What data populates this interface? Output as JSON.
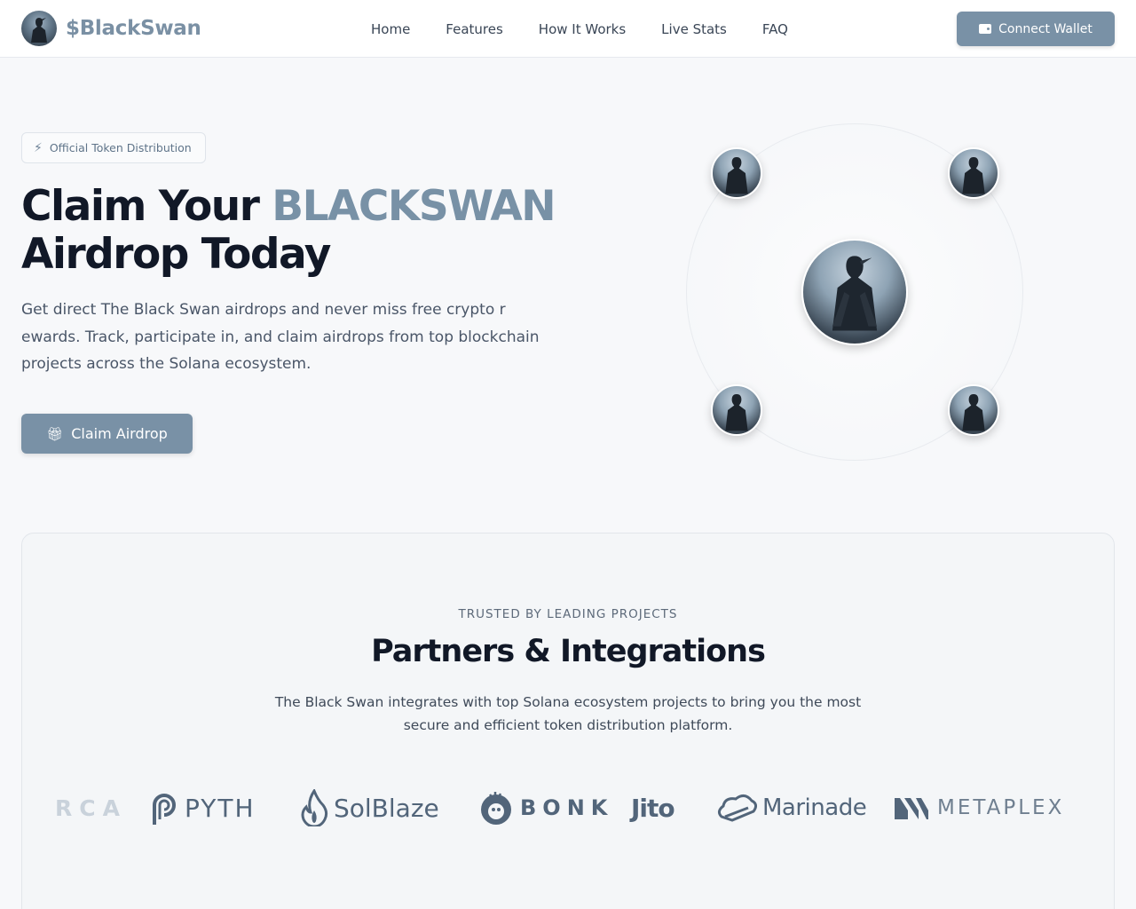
{
  "brand": {
    "name": "$BlackSwan",
    "avatar_icon": "black-swan-knight-icon"
  },
  "nav": {
    "links": [
      "Home",
      "Features",
      "How It Works",
      "Live Stats",
      "FAQ"
    ],
    "wallet_button": "Connect Wallet",
    "wallet_icon": "wallet-icon"
  },
  "hero": {
    "badge": "Official Token Distribution",
    "badge_icon": "bolt-icon",
    "title_prefix": "Claim Your ",
    "title_accent": "BLACKSWAN",
    "title_suffix": "Airdrop Today",
    "description": "Get direct The Black Swan airdrops and never miss free crypto r ewards. Track, participate in, and claim airdrops from top blockchain projects across the Solana ecosystem.",
    "cta": "Claim Airdrop",
    "cta_icon": "gift-icon"
  },
  "partners": {
    "eyebrow": "TRUSTED BY LEADING PROJECTS",
    "title": "Partners & Integrations",
    "description": "The Black Swan integrates with top Solana ecosystem projects to bring you the most secure and efficient token distribution platform.",
    "logos": [
      "RCA",
      "PYTH",
      "SolBlaze",
      "BONK",
      "Jito",
      "Marinade",
      "METAPLEX"
    ]
  },
  "colors": {
    "accent": "#7991a6",
    "text_dark": "#111827",
    "background": "#f7f8fa"
  }
}
